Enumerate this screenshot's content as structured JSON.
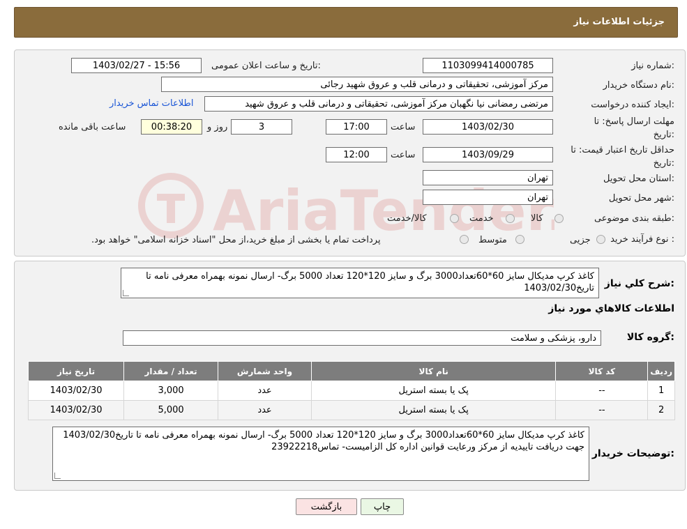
{
  "header": {
    "title": "جزئیات اطلاعات نیاز"
  },
  "form": {
    "need_number_label": "شماره نیاز:",
    "need_number": "1103099414000785",
    "announce_label": "تاریخ و ساعت اعلان عمومی:",
    "announce_value": "1403/02/27 - 15:56",
    "buyer_org_label": "نام دستگاه خریدار:",
    "buyer_org": "مرکز آموزشی، تحقیقاتی و درمانی قلب و عروق شهید رجائی",
    "creator_label": "ایجاد کننده درخواست:",
    "creator": "مرتضی رمضانی نیا نگهبان مرکز آموزشی، تحقیقاتی و درمانی قلب و عروق شهید",
    "contact_link": "اطلاعات تماس خریدار",
    "deadline_label_1": "مهلت ارسال پاسخ: تا",
    "deadline_label_2": "تاریخ:",
    "deadline_date": "1403/02/30",
    "time_label": "ساعت",
    "deadline_time": "17:00",
    "days_value": "3",
    "days_label": "روز و",
    "remaining_time": "00:38:20",
    "remaining_label": "ساعت باقی مانده",
    "validity_label_1": "حداقل تاریخ اعتبار قیمت: تا",
    "validity_label_2": "تاریخ:",
    "validity_date": "1403/09/29",
    "validity_time": "12:00",
    "province_label": "استان محل تحویل:",
    "province": "تهران",
    "city_label": "شهر محل تحویل:",
    "city": "تهران",
    "category_label": "طبقه بندی موضوعی:",
    "category_options": [
      "کالا",
      "خدمت",
      "کالا/خدمت"
    ],
    "process_label": "نوع فرآیند خرید :",
    "process_options": [
      "جزیی",
      "متوسط"
    ],
    "process_note": "پرداخت تمام یا بخشی از مبلغ خرید،از محل \"اسناد خزانه اسلامی\" خواهد بود."
  },
  "details": {
    "summary_label": "شرح کلي نياز:",
    "summary_text": "کاغذ کرپ مدیکال سایز 60*60تعداد3000 برگ و سایز 120*120 تعداد 5000 برگ- ارسال نمونه بهمراه معرفی نامه تا تاریخ1403/02/30",
    "goods_info_title": "اطلاعات کالاهاي مورد نياز",
    "goods_group_label": "گروه کالا:",
    "goods_group": "دارو، پزشکی و سلامت",
    "table": {
      "headers": [
        "ردیف",
        "کد کالا",
        "نام کالا",
        "واحد شمارش",
        "تعداد / مقدار",
        "تاریخ نیاز"
      ],
      "rows": [
        [
          "1",
          "--",
          "پک یا بسته استریل",
          "عدد",
          "3,000",
          "1403/02/30"
        ],
        [
          "2",
          "--",
          "پک یا بسته استریل",
          "عدد",
          "5,000",
          "1403/02/30"
        ]
      ]
    },
    "buyer_notes_label": "توضیحات خریدار:",
    "buyer_notes": "کاغذ کرپ مدیکال سایز 60*60تعداد3000 برگ و سایز 120*120 تعداد 5000 برگ- ارسال نمونه بهمراه معرفی نامه تا تاریخ1403/02/30 جهت دریافت تاییدیه از مرکز ورعایت قوانین اداره کل الزامیست- تماس23922218"
  },
  "buttons": {
    "print": "چاپ",
    "back": "بازگشت"
  },
  "watermark": {
    "text": "AriaTender.neT",
    "color": "#c9302c"
  }
}
